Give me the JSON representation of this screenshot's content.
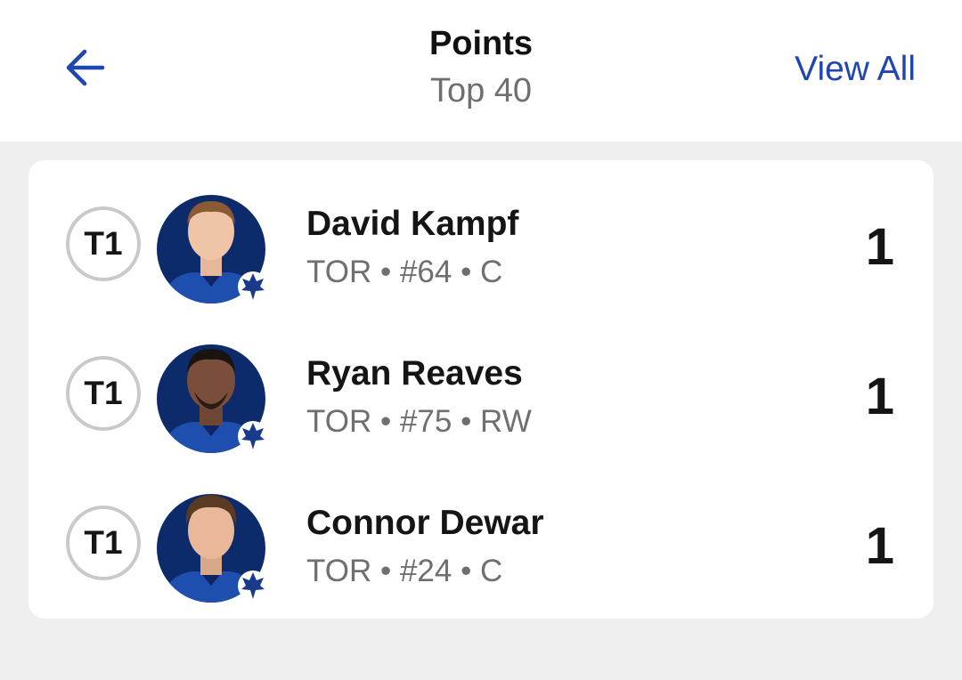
{
  "header": {
    "back_icon": "arrow-left-icon",
    "title": "Points",
    "subtitle": "Top 40",
    "view_all_label": "View All",
    "accent_color": "#1f45b0"
  },
  "leaders": [
    {
      "rank": "T1",
      "name": "David Kampf",
      "meta": "TOR • #64 • C",
      "value": "1",
      "team_logo": "maple-leaf-icon"
    },
    {
      "rank": "T1",
      "name": "Ryan Reaves",
      "meta": "TOR • #75 • RW",
      "value": "1",
      "team_logo": "maple-leaf-icon"
    },
    {
      "rank": "T1",
      "name": "Connor Dewar",
      "meta": "TOR • #24 • C",
      "value": "1",
      "team_logo": "maple-leaf-icon"
    }
  ]
}
